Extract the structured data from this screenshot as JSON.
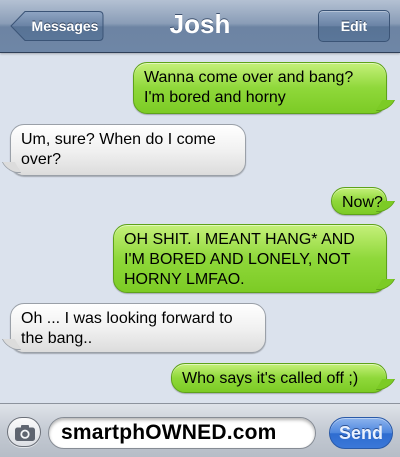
{
  "header": {
    "title": "Josh",
    "back_label": "Messages",
    "edit_label": "Edit"
  },
  "messages": [
    {
      "direction": "outgoing",
      "text": "Wanna come over and bang? I'm bored and horny"
    },
    {
      "direction": "incoming",
      "text": "Um, sure? When do I come over?"
    },
    {
      "direction": "outgoing",
      "text": "Now?"
    },
    {
      "direction": "outgoing",
      "text": "OH SHIT. I MEANT HANG* AND I'M BORED AND LONELY, NOT HORNY LMFAO."
    },
    {
      "direction": "incoming",
      "text": "Oh ... I was looking forward to the bang.."
    },
    {
      "direction": "outgoing",
      "text": "Who says it's called off ;)"
    }
  ],
  "compose": {
    "value": "smartphOWNED.com",
    "send_label": "Send",
    "camera_icon": "camera-icon"
  },
  "colors": {
    "outgoing_bubble": "#8fd83a",
    "incoming_bubble": "#f1f1f1",
    "navbar": "#6e86a6",
    "send_button": "#3b78d8",
    "background": "#dbe2ed"
  }
}
